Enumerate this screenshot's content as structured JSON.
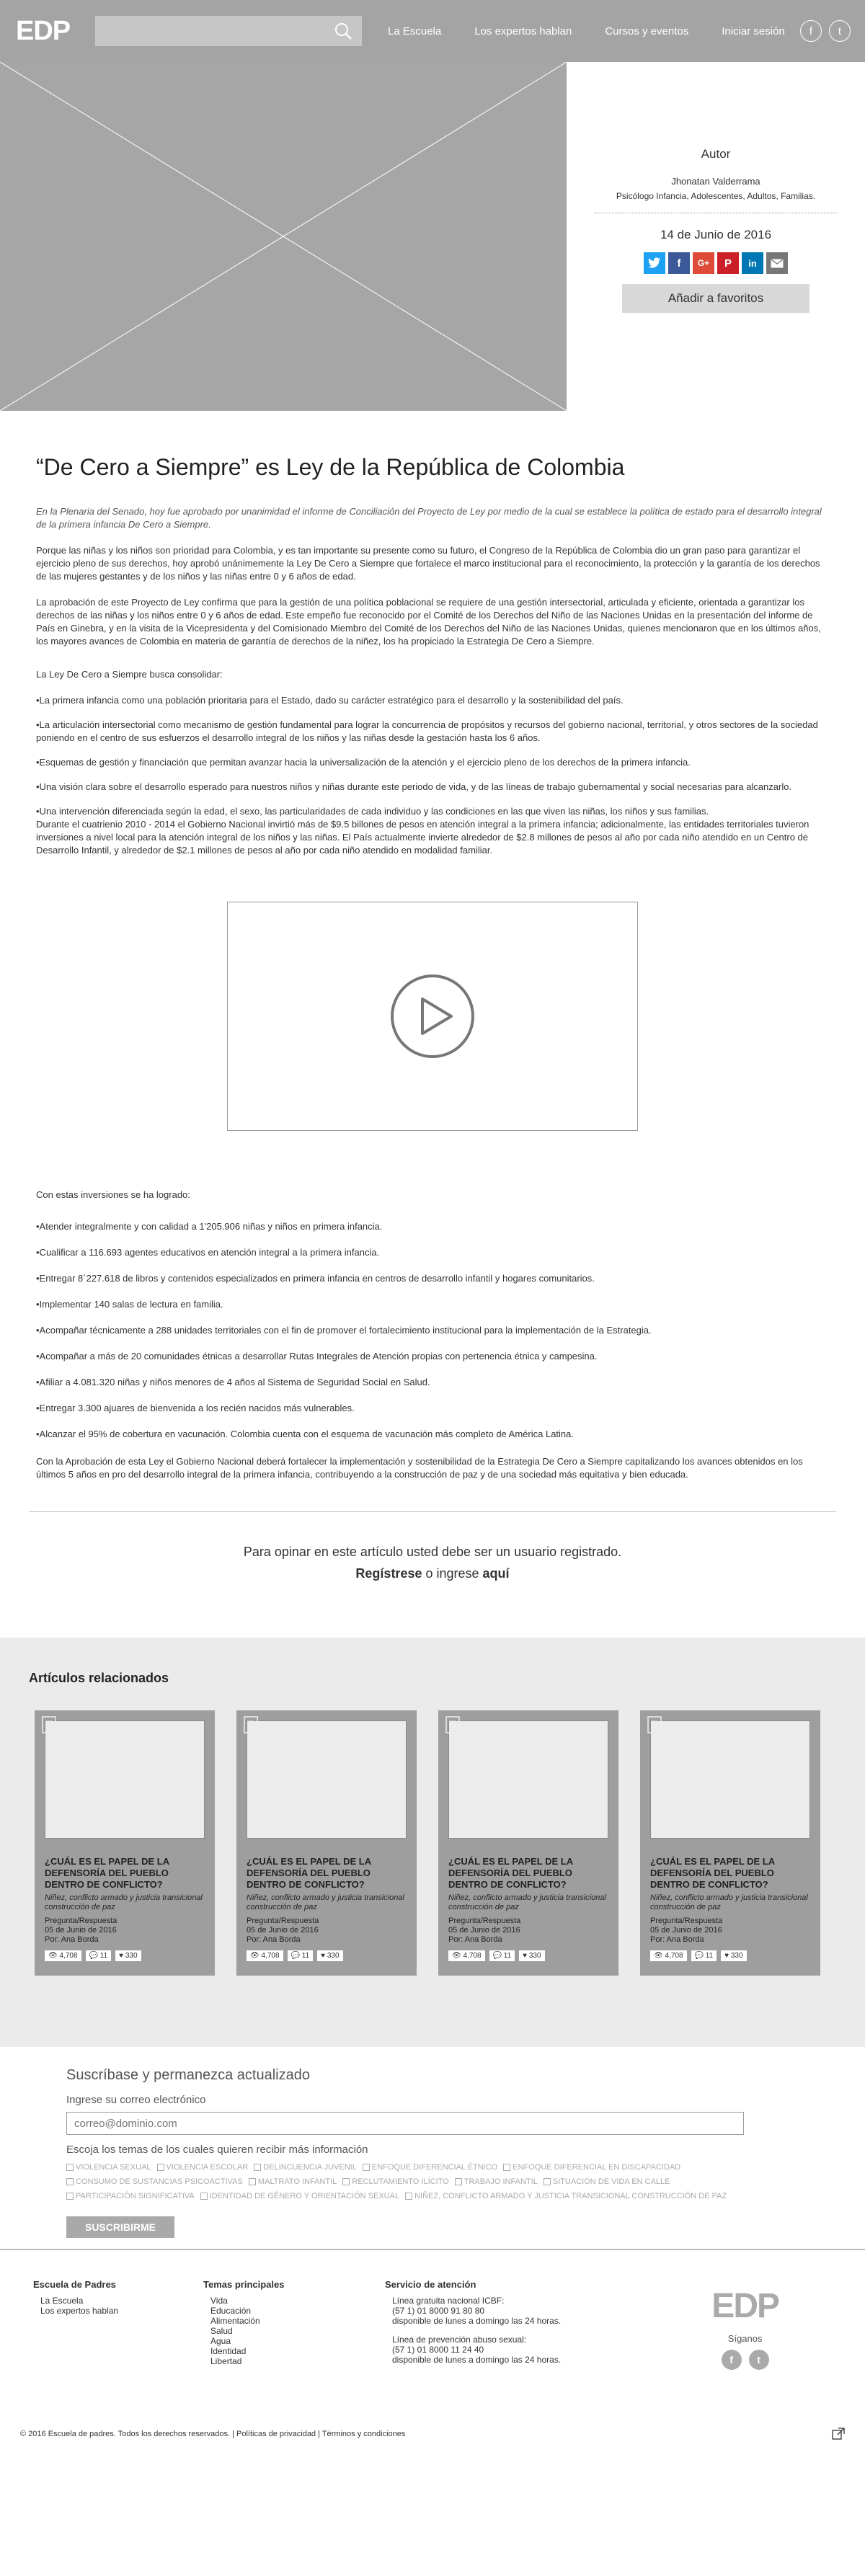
{
  "header": {
    "logo": "EDP",
    "nav": [
      "La Escuela",
      "Los expertos hablan",
      "Cursos y eventos",
      "Iniciar sesión"
    ],
    "social": [
      "f",
      "t"
    ]
  },
  "author": {
    "heading": "Autor",
    "name": "Jhonatan Valderrama",
    "description": "Psicólogo Infancia, Adolescentes, Adultos, Familias.",
    "date": "14 de Junio de 2016",
    "favorite_label": "Añadir a favoritos",
    "share_icons": [
      "twitter-icon",
      "facebook-icon",
      "google-plus-icon",
      "pinterest-icon",
      "linkedin-icon",
      "email-icon"
    ]
  },
  "article": {
    "title": "“De Cero a Siempre” es Ley de la República de Colombia",
    "lead": "En la Plenaria del Senado, hoy fue aprobado por unanimidad el informe de Conciliación del Proyecto de Ley por medio de la cual se establece la política de estado para el desarrollo integral de la primera infancia De Cero a Siempre.",
    "p1": "Porque las niñas y los niños son prioridad para Colombia, y es tan importante su presente como su futuro, el Congreso de la República de Colombia dio un gran paso para garantizar el ejercicio pleno de sus derechos, hoy aprobó unánimemente la Ley De Cero a Siempre que fortalece el marco institucional para el reconocimiento, la protección y la garantía de los derechos de las mujeres gestantes y de los niños y las niñas entre 0 y 6 años de edad.",
    "p2": "La aprobación de este Proyecto de Ley confirma que para la gestión de una política poblacional se requiere de una gestión intersectorial, articulada y eficiente, orientada a garantizar los derechos de las niñas y los niños entre 0 y 6 años de edad. Este empeño fue reconocido por el Comité de los Derechos del Niño de las Naciones Unidas en la presentación del informe de País en Ginebra, y en la visita de la Vicepresidenta y del Comisionado Miembro del Comité de los Derechos del Niño de las Naciones Unidas, quienes mencionaron que en los últimos años, los mayores avances de Colombia en materia de garantía de derechos de la niñez, los ha propiciado la Estrategia De Cero a Siempre.",
    "p3": "La Ley De Cero a Siempre busca consolidar:",
    "bullets": [
      "•La primera infancia como una población prioritaria para el Estado, dado su carácter estratégico para el desarrollo y la sostenibilidad del país.",
      "•La articulación intersectorial como mecanismo de gestión fundamental para lograr la concurrencia de propósitos y recursos del gobierno nacional, territorial, y otros sectores de la sociedad poniendo en el centro de sus esfuerzos el desarrollo integral de los niños y las niñas desde la gestación hasta los 6 años.",
      "•Esquemas de gestión y financiación que permitan avanzar hacia la universalización de la atención y el ejercicio pleno de los derechos de la primera infancia.",
      "•Una visión clara sobre el desarrollo esperado para nuestros niños y niñas durante este periodo de vida, y de las líneas de trabajo gubernamental y social necesarias para alcanzarlo.",
      "•Una intervención diferenciada según la edad, el sexo, las particularidades de cada individuo y las condiciones en las que viven las niñas, los niños y sus familias."
    ],
    "p4": "Durante el cuatrienio 2010 - 2014 el Gobierno Nacional invirtió más de $9.5 billones de pesos en atención integral a la primera infancia; adicionalmente, las entidades territoriales tuvieron inversiones a nivel local para la atención integral de los niños y las niñas.  El País actualmente invierte alrededor de $2.8 millones de pesos al año por cada niño atendido en un Centro de Desarrollo Infantil, y alrededor de $2.1 millones de pesos al año por cada niño atendido en modalidad familiar.",
    "achievements_intro": "Con estas inversiones se ha logrado:",
    "achievements": [
      "•Atender integralmente y con calidad a 1'205.906 niñas y niños en primera infancia.",
      "•Cualificar a 116.693 agentes educativos en atención integral a la primera infancia.",
      "•Entregar 8´227.618 de libros y contenidos especializados en primera infancia en centros de desarrollo infantil y hogares comunitarios.",
      "•Implementar 140 salas de lectura en familia.",
      "•Acompañar técnicamente a 288 unidades territoriales con el fin de promover el fortalecimiento institucional para la implementación de la Estrategia.",
      "•Acompañar a más de 20 comunidades étnicas a desarrollar Rutas Integrales de Atención propias con pertenencia étnica y campesina.",
      "•Afiliar a 4.081.320 niñas y niños menores de 4 años al Sistema de Seguridad Social en Salud.",
      "•Entregar 3.300 ajuares de bienvenida a los recién nacidos más vulnerables.",
      "•Alcanzar el 95% de cobertura en vacunación. Colombia cuenta con el esquema de vacunación más completo de América Latina."
    ],
    "closing": "Con la Aprobación de esta Ley el Gobierno Nacional deberá fortalecer la implementación y sostenibilidad de la Estrategia De Cero a Siempre capitalizando los avances obtenidos en los últimos 5 años en pro del desarrollo integral de la primera infancia, contribuyendo a la construcción de paz y de una sociedad más equitativa y bien educada."
  },
  "opinion": {
    "line1": "Para opinar en este artículo usted debe ser un usuario registrado.",
    "register": "Regístrese",
    "or": " o ingrese ",
    "here": "aquí"
  },
  "related": {
    "heading": "Artículos relacionados",
    "cards": [
      {
        "title": "¿CUÁL ES EL PAPEL DE LA DEFENSORÍA DEL PUEBLO DENTRO DE CONFLICTO?",
        "subtitle": "Niñez, conflicto armado y justicia transicional construcción de paz",
        "type": "Pregunta/Respuesta",
        "date": "05 de Junio de 2016",
        "author": "Por: Ana Borda",
        "views": "4,708",
        "comments": "11",
        "likes": "330"
      },
      {
        "title": "¿CUÁL ES EL PAPEL DE LA DEFENSORÍA DEL PUEBLO DENTRO DE CONFLICTO?",
        "subtitle": "Niñez, conflicto armado y justicia transicional construcción de paz",
        "type": "Pregunta/Respuesta",
        "date": "05 de Junio de 2016",
        "author": "Por: Ana Borda",
        "views": "4,708",
        "comments": "11",
        "likes": "330"
      },
      {
        "title": "¿CUÁL ES EL PAPEL DE LA DEFENSORÍA DEL PUEBLO DENTRO DE CONFLICTO?",
        "subtitle": "Niñez, conflicto armado y justicia transicional construcción de paz",
        "type": "Pregunta/Respuesta",
        "date": "05 de Junio de 2016",
        "author": "Por: Ana Borda",
        "views": "4,708",
        "comments": "11",
        "likes": "330"
      },
      {
        "title": "¿CUÁL ES EL PAPEL DE LA DEFENSORÍA DEL PUEBLO DENTRO DE CONFLICTO?",
        "subtitle": "Niñez, conflicto armado y justicia transicional construcción de paz",
        "type": "Pregunta/Respuesta",
        "date": "05 de Junio de 2016",
        "author": "Por: Ana Borda",
        "views": "4,708",
        "comments": "11",
        "likes": "330"
      }
    ]
  },
  "subscribe": {
    "heading": "Suscríbase y permanezca actualizado",
    "email_label": "Ingrese su correo electrónico",
    "email_placeholder": "correo@dominio.com",
    "topics_label": "Escoja los temas de los cuales quieren recibir más información",
    "topics": [
      "VIOLENCIA SEXUAL",
      "VIOLENCIA ESCOLAR",
      "DELINCUENCIA JUVENIL",
      "ENFOQUE DIFERENCIAL ÉTNICO",
      "ENFOQUE DIFERENCIAL EN DISCAPACIDAD",
      "CONSUMO DE SUSTANCIAS PSICOACTIVAS",
      "MALTRATO INFANTIL",
      "RECLUTAMIENTO ILÍCITO",
      "TRABAJO INFANTIL",
      "SITUACIÓN DE VIDA EN CALLE",
      "PARTICIPACIÓN SIGNIFICATIVA",
      "IDENTIDAD DE GÉNERO Y ORIENTACIÓN SEXUAL",
      "NIÑEZ, CONFLICTO ARMADO Y JUSTICIA TRANSICIONAL CONSTRUCCIÓN DE PAZ"
    ],
    "button": "SUSCRIBIRME"
  },
  "footer": {
    "col1": {
      "heading": "Escuela de Padres",
      "links": [
        "La Escuela",
        "Los expertos hablan"
      ]
    },
    "col2": {
      "heading": "Temas principales",
      "links": [
        "Vida",
        "Educación",
        "Alimentación",
        "Salud",
        "Agua",
        "Identidad",
        "Libertad"
      ]
    },
    "col3": {
      "heading": "Servicio de atención",
      "block1": [
        "Línea gratuita nacional ICBF:",
        "(57 1) 01 8000 91 80 80",
        "disponible de lunes a domingo las 24 horas."
      ],
      "block2": [
        "Línea de prevención abuso sexual:",
        "(57 1) 01 8000 11 24 40",
        "disponible de lunes a domingo las 24 horas."
      ]
    },
    "logo": "EDP",
    "follow": "Síganos",
    "social": [
      "f",
      "t"
    ]
  },
  "bottom": {
    "copyright": "© 2016 Escuela de padres.   Todos los derechos reservados.  |  Políticas de privacidad  |  Términos y condiciones"
  }
}
